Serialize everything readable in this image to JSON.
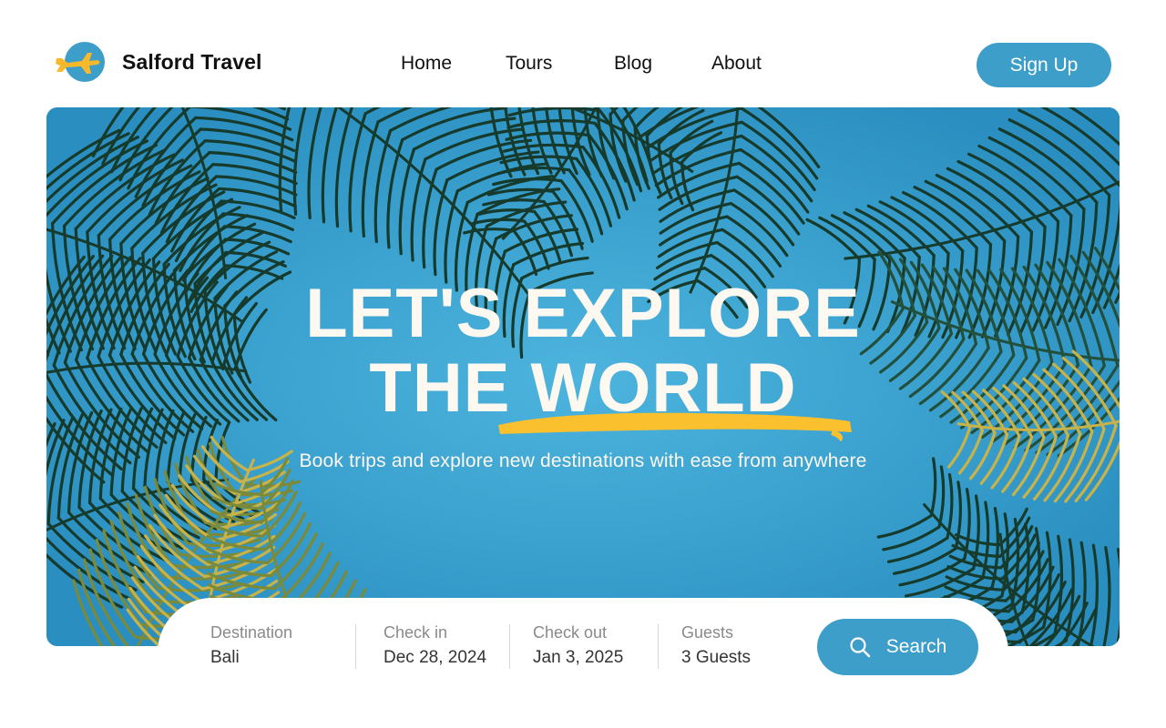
{
  "brand": {
    "name": "Salford Travel",
    "logo_icon": "airplane-icon"
  },
  "nav": {
    "items": [
      {
        "label": "Home"
      },
      {
        "label": "Tours"
      },
      {
        "label": "Blog"
      },
      {
        "label": "About"
      }
    ]
  },
  "header": {
    "signup_label": "Sign Up"
  },
  "hero": {
    "title_line1": "LET'S EXPLORE",
    "title_line2": "THE WORLD",
    "subtitle": "Book trips and explore new destinations with ease from anywhere"
  },
  "search": {
    "fields": [
      {
        "label": "Destination",
        "value": "Bali"
      },
      {
        "label": "Check in",
        "value": "Dec 28, 2024"
      },
      {
        "label": "Check out",
        "value": "Jan 3, 2025"
      },
      {
        "label": "Guests",
        "value": "3 Guests"
      }
    ],
    "button_label": "Search",
    "button_icon": "search-icon"
  },
  "colors": {
    "accent": "#3d9ec9",
    "highlight": "#fbc02d",
    "hero_text": "#fdf8f0"
  }
}
